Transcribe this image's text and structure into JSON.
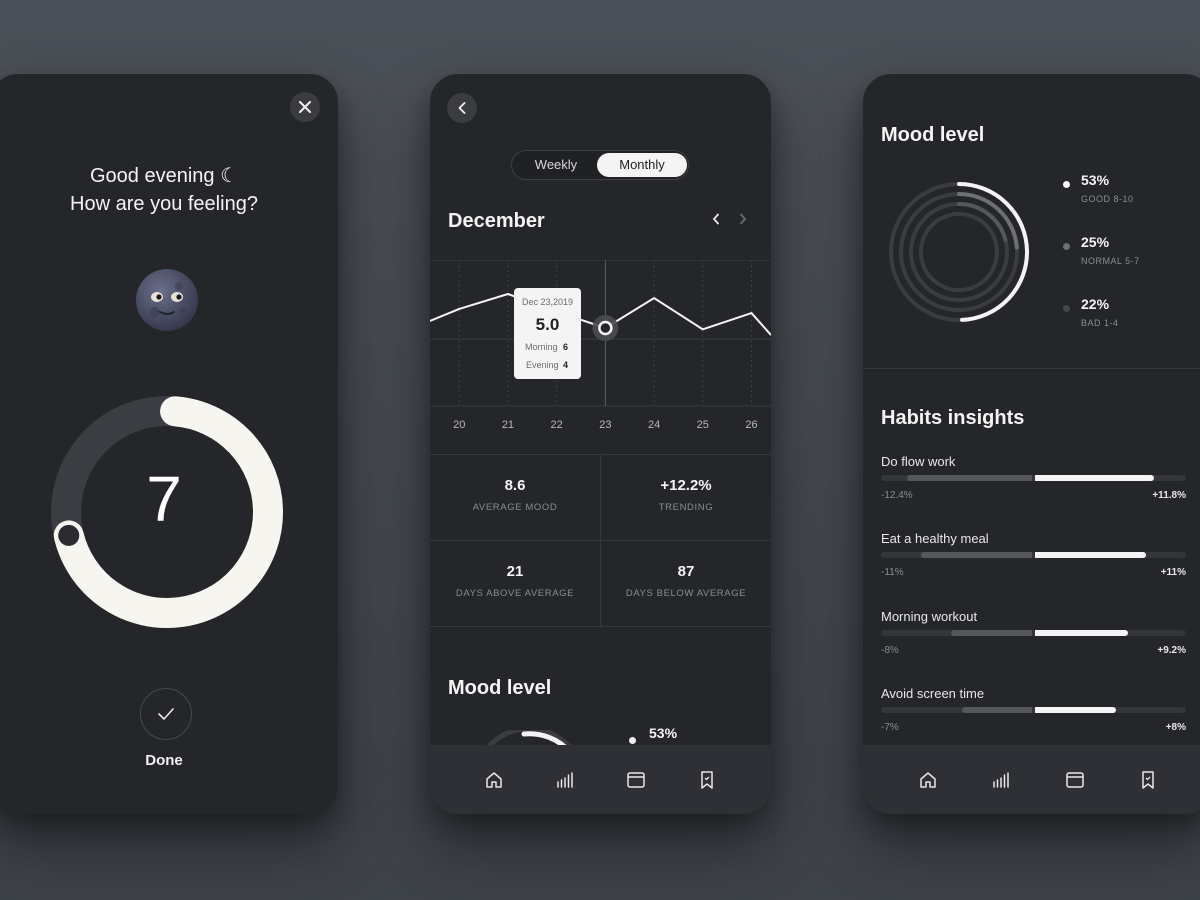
{
  "checkin": {
    "greeting_line1": "Good evening ☾",
    "greeting_line2": "How are you feeling?",
    "mood_value": "7",
    "mood_fraction": 0.7,
    "done_label": "Done"
  },
  "stats_screen": {
    "tabs": [
      "Weekly",
      "Monthly"
    ],
    "active_tab": "Monthly",
    "month": "December",
    "tooltip": {
      "date": "Dec 23,2019",
      "value": "5.0",
      "morning_label": "Morning",
      "morning_value": "6",
      "evening_label": "Evening",
      "evening_value": "4"
    },
    "stats": [
      {
        "value": "8.6",
        "label": "AVERAGE MOOD"
      },
      {
        "value": "+12.2%",
        "label": "TRENDING"
      },
      {
        "value": "21",
        "label": "DAYS ABOVE AVERAGE"
      },
      {
        "value": "87",
        "label": "DAYS BELOW AVERAGE"
      }
    ],
    "mood_level_title": "Mood level",
    "mood_level_peek": "53%"
  },
  "chart_data": {
    "type": "line",
    "x": [
      "20",
      "21",
      "22",
      "23",
      "24",
      "25",
      "26"
    ],
    "series": [
      {
        "values": [
          6.4,
          7.5,
          6.2,
          5.0,
          7.2,
          4.9,
          6.1
        ]
      }
    ],
    "x_range": [
      19.4,
      26.4
    ],
    "ylim": [
      0,
      10
    ],
    "grid": true,
    "highlight_x": "23"
  },
  "insights_screen": {
    "mood_level_title": "Mood level",
    "levels": [
      {
        "pct": "53%",
        "label": "GOOD 8-10",
        "fraction": 0.53,
        "color": "#f4f4f4"
      },
      {
        "pct": "25%",
        "label": "NORMAL 5-7",
        "fraction": 0.25,
        "color": "#6d6f75"
      },
      {
        "pct": "22%",
        "label": "BAD 1-4",
        "fraction": 0.22,
        "color": "#45474d"
      }
    ],
    "habits_title": "Habits insights",
    "habits": [
      {
        "name": "Do flow work",
        "neg": "-12.4%",
        "pos": "+11.8%",
        "neg_fraction": 0.124,
        "pos_fraction": 0.118
      },
      {
        "name": "Eat a healthy meal",
        "neg": "-11%",
        "pos": "+11%",
        "neg_fraction": 0.11,
        "pos_fraction": 0.11
      },
      {
        "name": "Morning workout",
        "neg": "-8%",
        "pos": "+9.2%",
        "neg_fraction": 0.08,
        "pos_fraction": 0.092
      },
      {
        "name": "Avoid screen time",
        "neg": "-7%",
        "pos": "+8%",
        "neg_fraction": 0.07,
        "pos_fraction": 0.08
      }
    ]
  },
  "tabbar_icons": [
    "home-icon",
    "stats-icon",
    "calendar-icon",
    "bookmark-icon"
  ],
  "colors": {
    "background": "#464a51",
    "card": "#24262a",
    "accent": "#f4f4f4"
  }
}
